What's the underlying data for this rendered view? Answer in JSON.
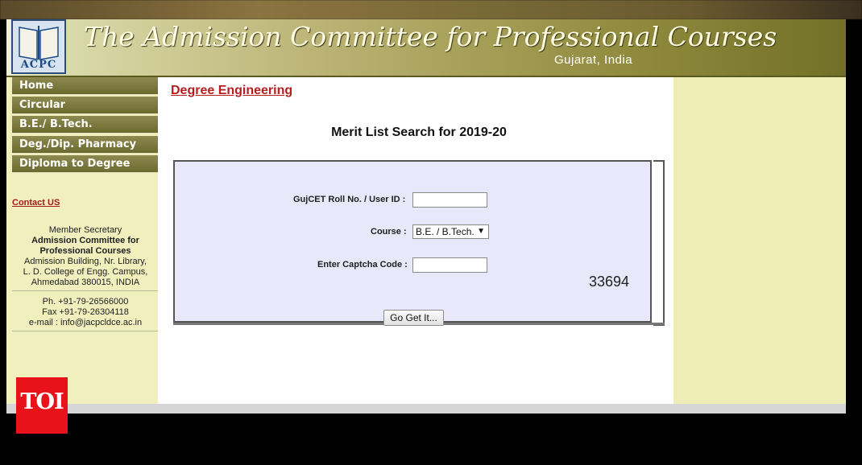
{
  "header": {
    "logo_text": "ACPC",
    "title": "The Admission Committee for Professional Courses",
    "subtitle": "Gujarat, India"
  },
  "sidebar": {
    "nav": [
      "Home",
      "Circular",
      "B.E./ B.Tech.",
      "Deg./Dip. Pharmacy",
      "Diploma to Degree"
    ],
    "contact_label": "Contact US",
    "address": {
      "line1": "Member Secretary",
      "line2": "Admission Committee for",
      "line3": "Professional Courses",
      "line4": "Admission Building, Nr. Library,",
      "line5": "L. D. College of Engg. Campus,",
      "line6": "Ahmedabad 380015, INDIA"
    },
    "phones": {
      "phone": "Ph. +91-79-26566000",
      "fax": "Fax +91-79-26304118",
      "email": "e-mail : info@jacpcldce.ac.in"
    }
  },
  "main": {
    "section_heading": "Degree Engineering",
    "page_title": "Merit List Search for 2019-20",
    "form": {
      "roll_label": "GujCET Roll No. / User ID :",
      "roll_value": "",
      "course_label": "Course :",
      "course_selected": "B.E. / B.Tech.",
      "captcha_label": "Enter Captcha Code :",
      "captcha_value": "",
      "captcha_code": "33694",
      "submit_label": "Go Get It..."
    }
  },
  "watermark": {
    "text": "TOI",
    "color": "#e8121a"
  }
}
